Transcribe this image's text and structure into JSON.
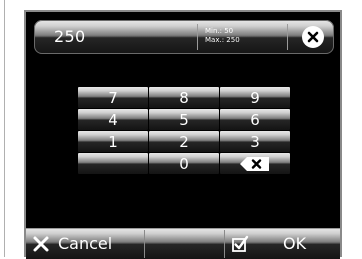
{
  "entry": {
    "value": "250",
    "min_label": "Min.: 50",
    "max_label": "Max.: 250"
  },
  "keypad": {
    "rows": [
      [
        "7",
        "8",
        "9"
      ],
      [
        "4",
        "5",
        "6"
      ],
      [
        "1",
        "2",
        "3"
      ],
      [
        "",
        "0",
        ""
      ]
    ]
  },
  "footer": {
    "cancel_label": "Cancel",
    "ok_label": "OK"
  },
  "icons": {
    "clear": "clear-icon",
    "backspace": "backspace-icon",
    "cancel": "cancel-x-icon",
    "ok": "check-box-icon"
  }
}
